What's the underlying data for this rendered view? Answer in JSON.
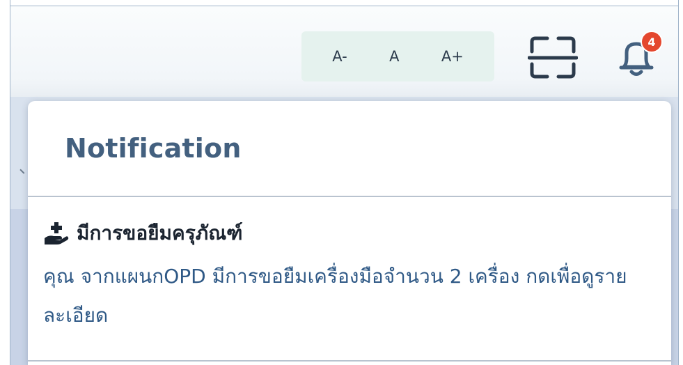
{
  "toolbar": {
    "font_decrease_label": "A-",
    "font_reset_label": "A",
    "font_increase_label": "A+",
    "scan_icon": "scan-frame-icon",
    "bell_icon": "bell-icon",
    "notification_count": "4"
  },
  "notification_panel": {
    "title": "Notification",
    "items": [
      {
        "icon": "hand-holding-medical-icon",
        "title": "มีการขอยืมครุภัณฑ์",
        "body": "คุณ จากแผนกOPD มีการขอยืมเครื่องมือจำนวน 2 เครื่อง กดเพื่อดูรายละเอียด"
      }
    ]
  },
  "colors": {
    "accent": "#43607f",
    "link_text": "#2f5986",
    "badge": "#e4472e",
    "font_group_bg": "#e5f2ee"
  }
}
